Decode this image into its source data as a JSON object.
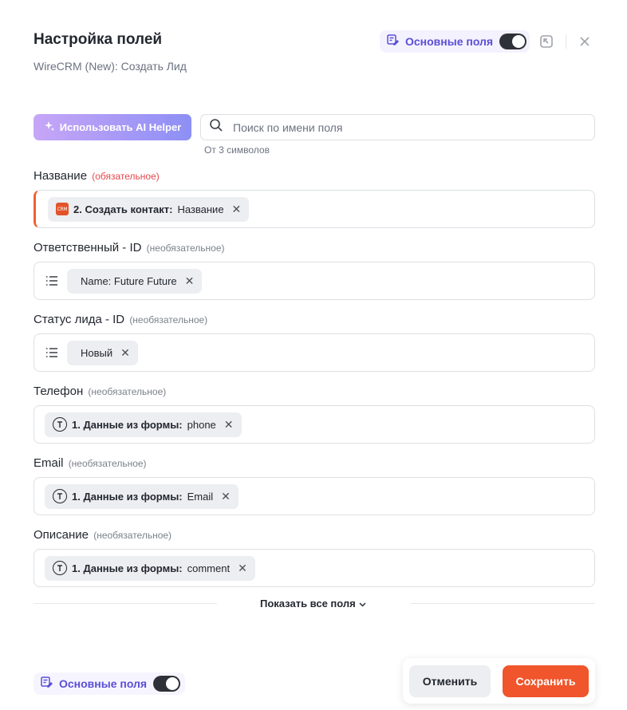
{
  "header": {
    "title": "Настройка полей",
    "subtitle": "WireCRM (New): Создать Лид",
    "main_fields_toggle_label": "Основные поля",
    "main_fields_toggle_on": true
  },
  "toolbar": {
    "ai_helper_label": "Использовать AI Helper",
    "search_placeholder": "Поиск по имени поля",
    "search_value": "",
    "search_hint": "От 3 символов"
  },
  "fields": [
    {
      "label": "Название",
      "tag": "(обязательное)",
      "chip_source": "2. Создать контакт:",
      "chip_value": "Название",
      "app_badge": "CRM"
    },
    {
      "label": "Ответственный - ID",
      "tag": "(необязательное)",
      "chip_value": "Name: Future Future"
    },
    {
      "label": "Статус лида - ID",
      "tag": "(необязательное)",
      "chip_value": "Новый"
    },
    {
      "label": "Телефон",
      "tag": "(необязательное)",
      "chip_source": "1. Данные из формы:",
      "chip_value": "phone"
    },
    {
      "label": "Email",
      "tag": "(необязательное)",
      "chip_source": "1. Данные из формы:",
      "chip_value": "Email"
    },
    {
      "label": "Описание",
      "tag": "(необязательное)",
      "chip_source": "1. Данные из формы:",
      "chip_value": "comment"
    }
  ],
  "show_all_label": "Показать все поля",
  "footer": {
    "main_fields_toggle_label": "Основные поля",
    "cancel_label": "Отменить",
    "save_label": "Сохранить"
  },
  "colors": {
    "accent_purple": "#5b4fd6",
    "save_orange": "#f0552b",
    "required_red": "#e5484d"
  }
}
